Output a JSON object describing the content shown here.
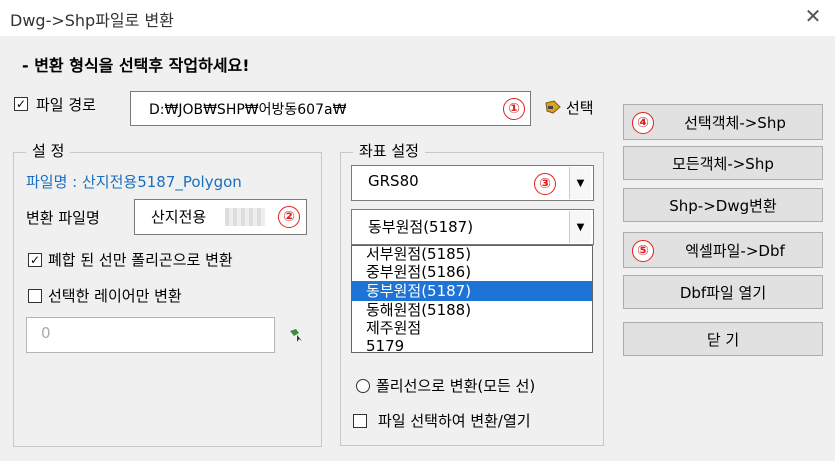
{
  "window": {
    "title": "Dwg->Shp파일로 변환",
    "close_glyph": "✕"
  },
  "heading": "- 변환 형식을 선택후 작업하세요!",
  "file_path": {
    "label": "파일 경로",
    "value": "D:₩JOB₩SHP₩어방동607a₩",
    "checked": true,
    "check_glyph": "✓",
    "badge": "①"
  },
  "select_label": "선택",
  "settings": {
    "legend": "설 정",
    "filename_text": "파일명 : 산지전용5187_Polygon",
    "convert_name_label": "변환 파일명",
    "convert_name_value": "산지전용",
    "convert_name_badge": "②",
    "closed_polyline": {
      "label": "폐합 된 선만 폴리곤으로 변환",
      "checked": true,
      "check_glyph": "✓"
    },
    "selected_layers": {
      "label": "선택한 레이어만 변환",
      "checked": false
    },
    "layer_value": "0"
  },
  "coord": {
    "legend": "좌표 설정",
    "system_value": "GRS80",
    "system_badge": "③",
    "origin_value": "동부원점(5187)",
    "arrow_glyph": "▼",
    "options": [
      "서부원점(5185)",
      "중부원점(5186)",
      "동부원점(5187)",
      "동해원점(5188)",
      "제주원점",
      "5179"
    ],
    "selected_index": 2,
    "radio_polyline": "폴리선으로 변환(모든 선)",
    "file_select_label": "파일 선택하여 변환/열기"
  },
  "buttons": {
    "selected_to_shp": "선택객체->Shp",
    "badge4": "④",
    "all_to_shp": "모든객체->Shp",
    "shp_to_dwg": "Shp->Dwg변환",
    "excel_to_dbf": "엑셀파일->Dbf",
    "badge5": "⑤",
    "open_dbf": "Dbf파일 열기",
    "close": "닫 기"
  },
  "colors": {
    "accent_blue": "#1e73d6",
    "badge_red": "#e02020",
    "link_blue": "#1a6fc0"
  }
}
